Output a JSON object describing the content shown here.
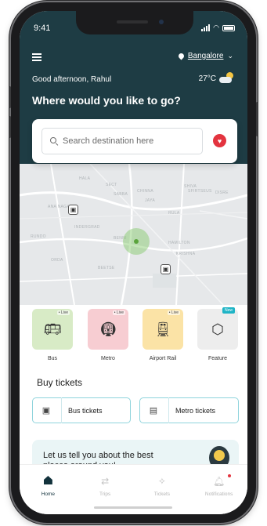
{
  "status_bar": {
    "time": "9:41"
  },
  "header": {
    "location": "Bangalore",
    "greeting": "Good afternoon, Rahul",
    "temperature": "27°C",
    "headline": "Where would you like to go?"
  },
  "search": {
    "placeholder": "Search destination here"
  },
  "map": {
    "labels": [
      "HALA",
      "SECT",
      "CHINNA",
      "SHIVA",
      "SFIRTSEUS",
      "SABBA",
      "JAYA",
      "DISRE",
      "ANA NAGAR",
      "RULA",
      "INDERGRAD",
      "RUNDO",
      "BENNI",
      "HAMILTON",
      "KRISHNA",
      "ORDA",
      "BEETSE"
    ]
  },
  "transport_modes": [
    {
      "label": "Bus",
      "badge": "• Live",
      "icon": "bus-icon",
      "color": "#d8ebc6"
    },
    {
      "label": "Metro",
      "badge": "• Live",
      "icon": "metro-icon",
      "color": "#f7cdd2"
    },
    {
      "label": "Airport Rail",
      "badge": "• Live",
      "icon": "airport-rail-icon",
      "color": "#fbe3a6"
    },
    {
      "label": "Feature",
      "badge": "New",
      "icon": "feature-box-icon",
      "color": "#ededed"
    }
  ],
  "buy_tickets": {
    "title": "Buy tickets",
    "bus_label": "Bus tickets",
    "metro_label": "Metro tickets"
  },
  "promo": {
    "text": "Let us tell you about the best places around you!"
  },
  "tabs": [
    {
      "label": "Home",
      "icon": "home-icon",
      "active": true
    },
    {
      "label": "Trips",
      "icon": "trips-icon",
      "active": false
    },
    {
      "label": "Tickets",
      "icon": "tickets-icon",
      "active": false
    },
    {
      "label": "Notifications",
      "icon": "bell-icon",
      "active": false
    }
  ],
  "colors": {
    "header_bg": "#1e3c44",
    "accent": "#e3343f",
    "ticket_border": "#8fd4dc"
  }
}
